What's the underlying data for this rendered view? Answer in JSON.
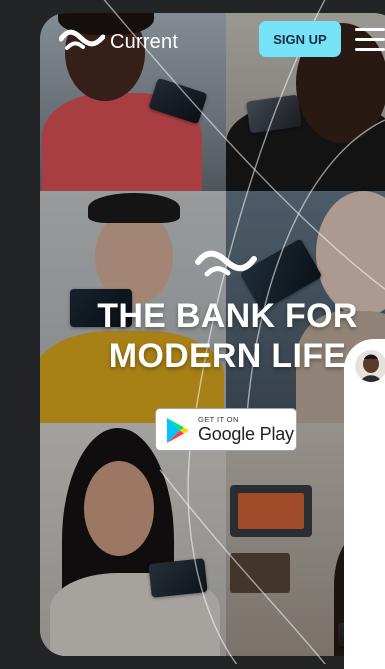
{
  "header": {
    "brand": "Current",
    "signup_label": "SIGN UP"
  },
  "hero": {
    "headline_line1": "THE BANK FOR",
    "headline_line2": "MODERN LIFE"
  },
  "store_badge": {
    "prefix": "GET IT ON",
    "store": "Google Play"
  },
  "colors": {
    "accent": "#76e3f6",
    "page_background": "#232425",
    "headline": "#ffffff"
  },
  "icons": [
    "current-logo-icon",
    "menu-icon",
    "google-play-icon",
    "chat-avatar-icon"
  ]
}
